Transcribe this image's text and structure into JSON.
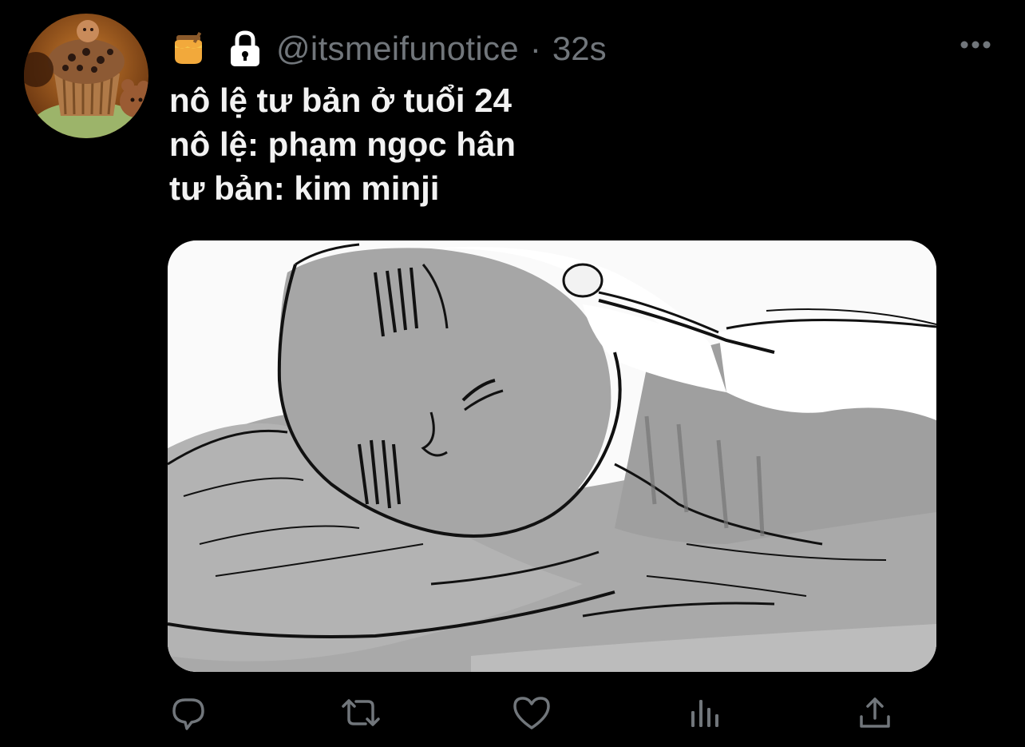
{
  "tweet": {
    "emoji_icon": "honey-pot-icon",
    "lock_icon": "lock-icon",
    "handle": "@itsmeifunotice",
    "separator": "·",
    "time": "32s",
    "lines": [
      "nô lệ tư bản ở tuổi 24",
      "nô lệ: phạm ngọc hân",
      "tư bản: kim minji"
    ]
  },
  "actions": {
    "reply_icon": "reply-icon",
    "retweet_icon": "retweet-icon",
    "like_icon": "heart-icon",
    "analytics_icon": "analytics-icon",
    "share_icon": "share-icon"
  },
  "colors": {
    "background": "#000000",
    "text": "#f2f2f2",
    "secondary": "#71767b"
  }
}
